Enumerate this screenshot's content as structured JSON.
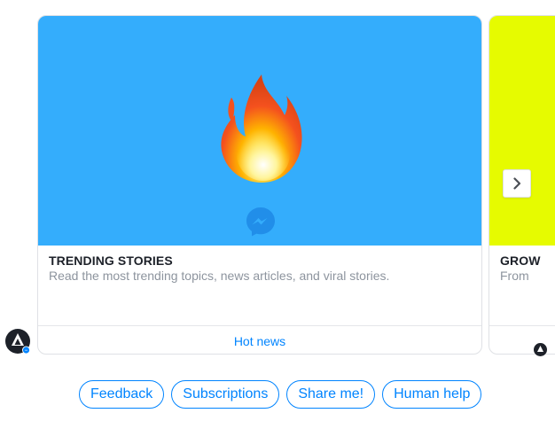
{
  "cards": [
    {
      "title": "TRENDING STORIES",
      "subtitle": "Read the most trending topics, news articles, and viral stories.",
      "action": "Hot news",
      "image_color": "#34adfc",
      "image_icon": "fire-emoji"
    },
    {
      "title": "GROW",
      "subtitle": "From",
      "image_color": "#e6fb00"
    }
  ],
  "quick_replies": [
    "Feedback",
    "Subscriptions",
    "Share me!",
    "Human help"
  ],
  "colors": {
    "accent": "#0084ff",
    "card_border": "#dfe1e5",
    "subtitle": "#8d949e"
  },
  "icons": {
    "next": "chevron-right-icon",
    "badge": "messenger-icon",
    "avatar": "bot-avatar-icon"
  }
}
